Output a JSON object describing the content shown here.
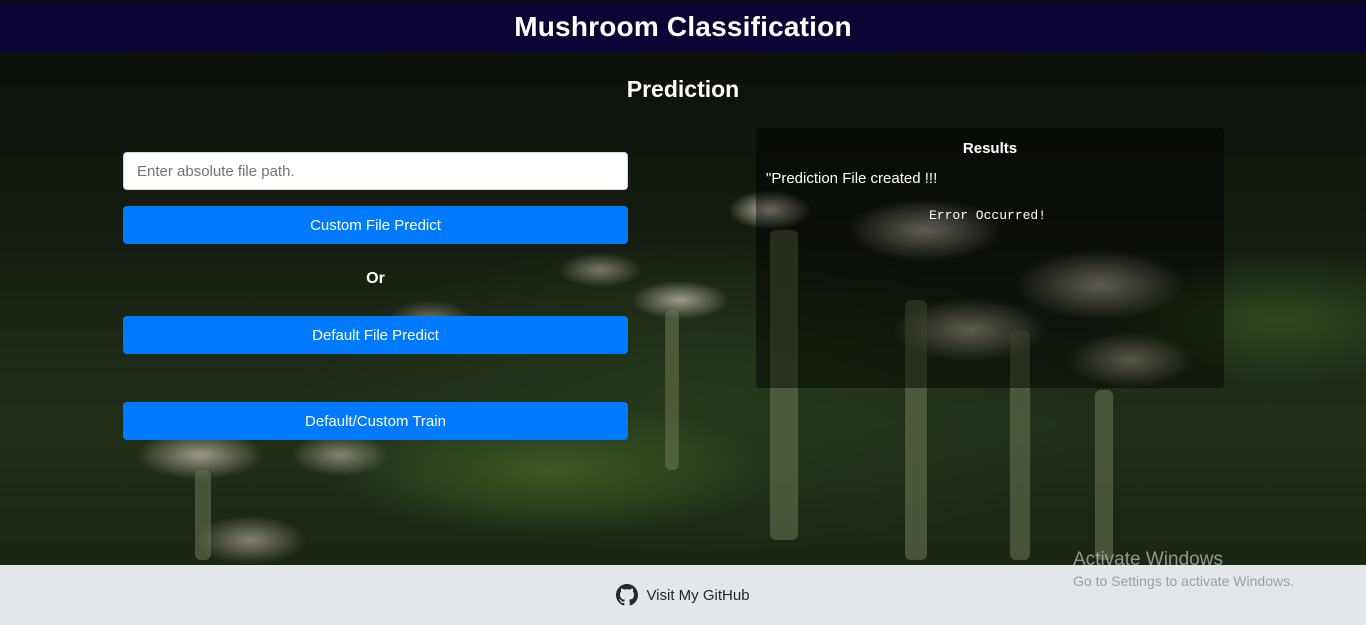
{
  "header": {
    "title": "Mushroom Classification"
  },
  "page": {
    "subtitle": "Prediction"
  },
  "form": {
    "file_path_placeholder": "Enter absolute file path.",
    "custom_predict_label": "Custom File Predict",
    "or_label": "Or",
    "default_predict_label": "Default File Predict",
    "train_label": "Default/Custom Train"
  },
  "results": {
    "title": "Results",
    "message": "\"Prediction File created !!!",
    "error": "Error Occurred!"
  },
  "footer": {
    "github_label": "Visit My GitHub",
    "icon": "github-icon"
  },
  "watermark": {
    "line1": "Activate Windows",
    "line2": "Go to Settings to activate Windows."
  },
  "colors": {
    "header_bg": "#0b0535",
    "button_bg": "#007bff",
    "footer_bg": "#e4e7ea"
  }
}
